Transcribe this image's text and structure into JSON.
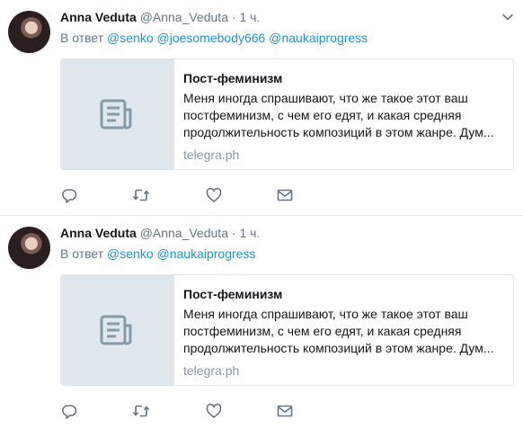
{
  "tweets": [
    {
      "name": "Anna Veduta",
      "handle": "@Anna_Veduta",
      "dot": "·",
      "time": "1 ч.",
      "reply_prefix": "В ответ",
      "mentions": [
        "@senko",
        "@joesomebody666",
        "@naukaiprogress"
      ],
      "card": {
        "title": "Пост-феминизм",
        "description": "Меня иногда спрашивают, что же такое этот ваш постфеминизм, с чем его едят, и какая средняя продолжительность композиций в этом жанре. Дум...",
        "domain": "telegra.ph"
      }
    },
    {
      "name": "Anna Veduta",
      "handle": "@Anna_Veduta",
      "dot": "·",
      "time": "1 ч.",
      "reply_prefix": "В ответ",
      "mentions": [
        "@senko",
        "@naukaiprogress"
      ],
      "card": {
        "title": "Пост-феминизм",
        "description": "Меня иногда спрашивают, что же такое этот ваш постфеминизм, с чем его едят, и какая средняя продолжительность композиций в этом жанре. Дум...",
        "domain": "telegra.ph"
      }
    }
  ],
  "icons": {
    "reply": "reply-icon",
    "retweet": "retweet-icon",
    "like": "heart-icon",
    "dm": "envelope-icon",
    "caret": "chevron-down-icon",
    "card_placeholder": "document-icon"
  },
  "colors": {
    "link": "#1b95e0",
    "secondary_text": "#657786",
    "icon": "#657786",
    "card_thumb": "#e1e8ed"
  }
}
